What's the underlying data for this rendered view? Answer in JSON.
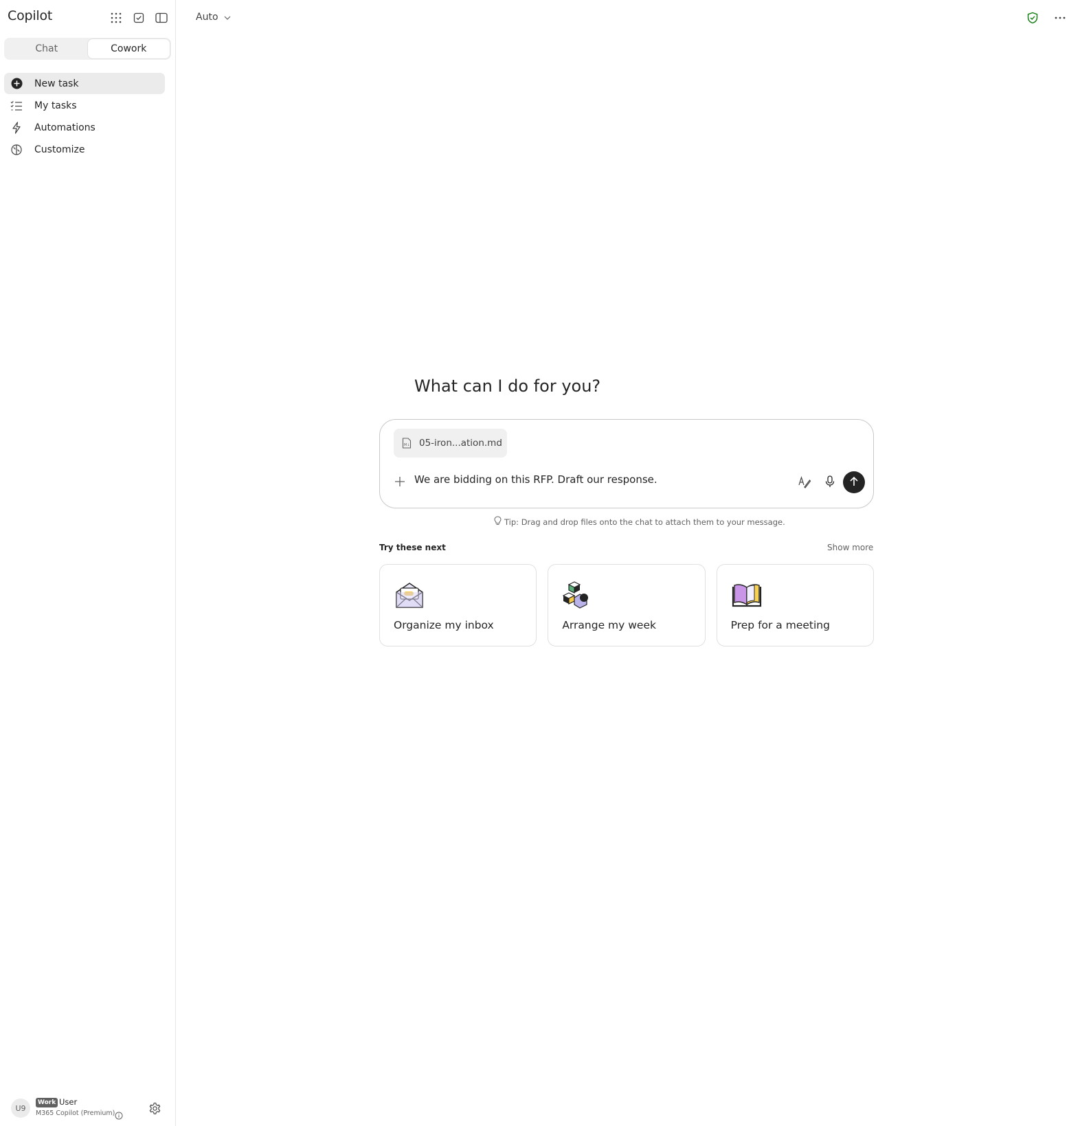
{
  "app": {
    "title": "Copilot"
  },
  "sidebar": {
    "icons": [
      "apps-grid-icon",
      "tasks-check-icon",
      "panel-toggle-icon"
    ],
    "mode_tabs": [
      {
        "label": "Chat",
        "active": false
      },
      {
        "label": "Cowork",
        "active": true
      }
    ],
    "nav": [
      {
        "label": "New task",
        "icon": "add-circle-icon",
        "active": true
      },
      {
        "label": "My tasks",
        "icon": "task-list-icon",
        "active": false
      },
      {
        "label": "Automations",
        "icon": "flash-icon",
        "active": false
      },
      {
        "label": "Customize",
        "icon": "brain-icon",
        "active": false
      }
    ],
    "user": {
      "initials": "U9",
      "badge": "Work",
      "name": "User",
      "plan": "M365 Copilot (Premium)"
    }
  },
  "header": {
    "model": "Auto"
  },
  "main": {
    "greeting": "What can I do for you?",
    "composer": {
      "attachment": "05-iron...ation.md",
      "text": "We are bidding on this RFP. Draft our response."
    },
    "tip": "Tip: Drag and drop files onto the chat to attach them to your message.",
    "suggestions_heading": "Try these next",
    "show_more": "Show more",
    "cards": [
      {
        "label": "Organize my inbox",
        "icon": "envelope-icon"
      },
      {
        "label": "Arrange my week",
        "icon": "blocks-icon"
      },
      {
        "label": "Prep for a meeting",
        "icon": "book-icon"
      }
    ]
  },
  "colors": {
    "accent_dark": "#242424",
    "shield_green": "#107c10",
    "selected_bg": "#ebebeb"
  }
}
